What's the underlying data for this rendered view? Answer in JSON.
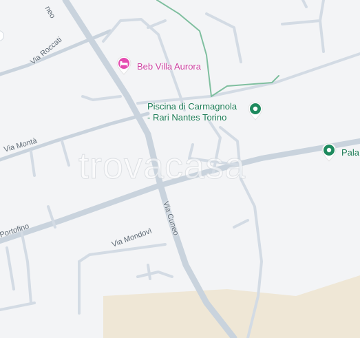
{
  "map": {
    "colors": {
      "background": "#f3f4f6",
      "road": "#c9d3dd",
      "footpath": "#7fbf9f",
      "sand_area": "#efe7d6",
      "hotel_pin": "#e54bb0",
      "sport_pin": "#1e8a5e"
    },
    "streets": {
      "via_roccati": "Via Roccati",
      "via_monta": "Via Montà",
      "via_portofino": "Portofino",
      "via_cuneo": "Via Cuneo",
      "via_mondovi": "Via Mondovì",
      "top_cut": "neo"
    },
    "pois": {
      "hotel": {
        "label": "Beb Villa Aurora",
        "icon": "bed-icon"
      },
      "pool": {
        "line1": "Piscina di Carmagnola",
        "line2": "- Rari Nantes Torino",
        "icon": "map-pin-icon"
      },
      "pala": {
        "label": "Pala",
        "icon": "map-pin-icon"
      }
    },
    "watermark": "trovacasa"
  }
}
